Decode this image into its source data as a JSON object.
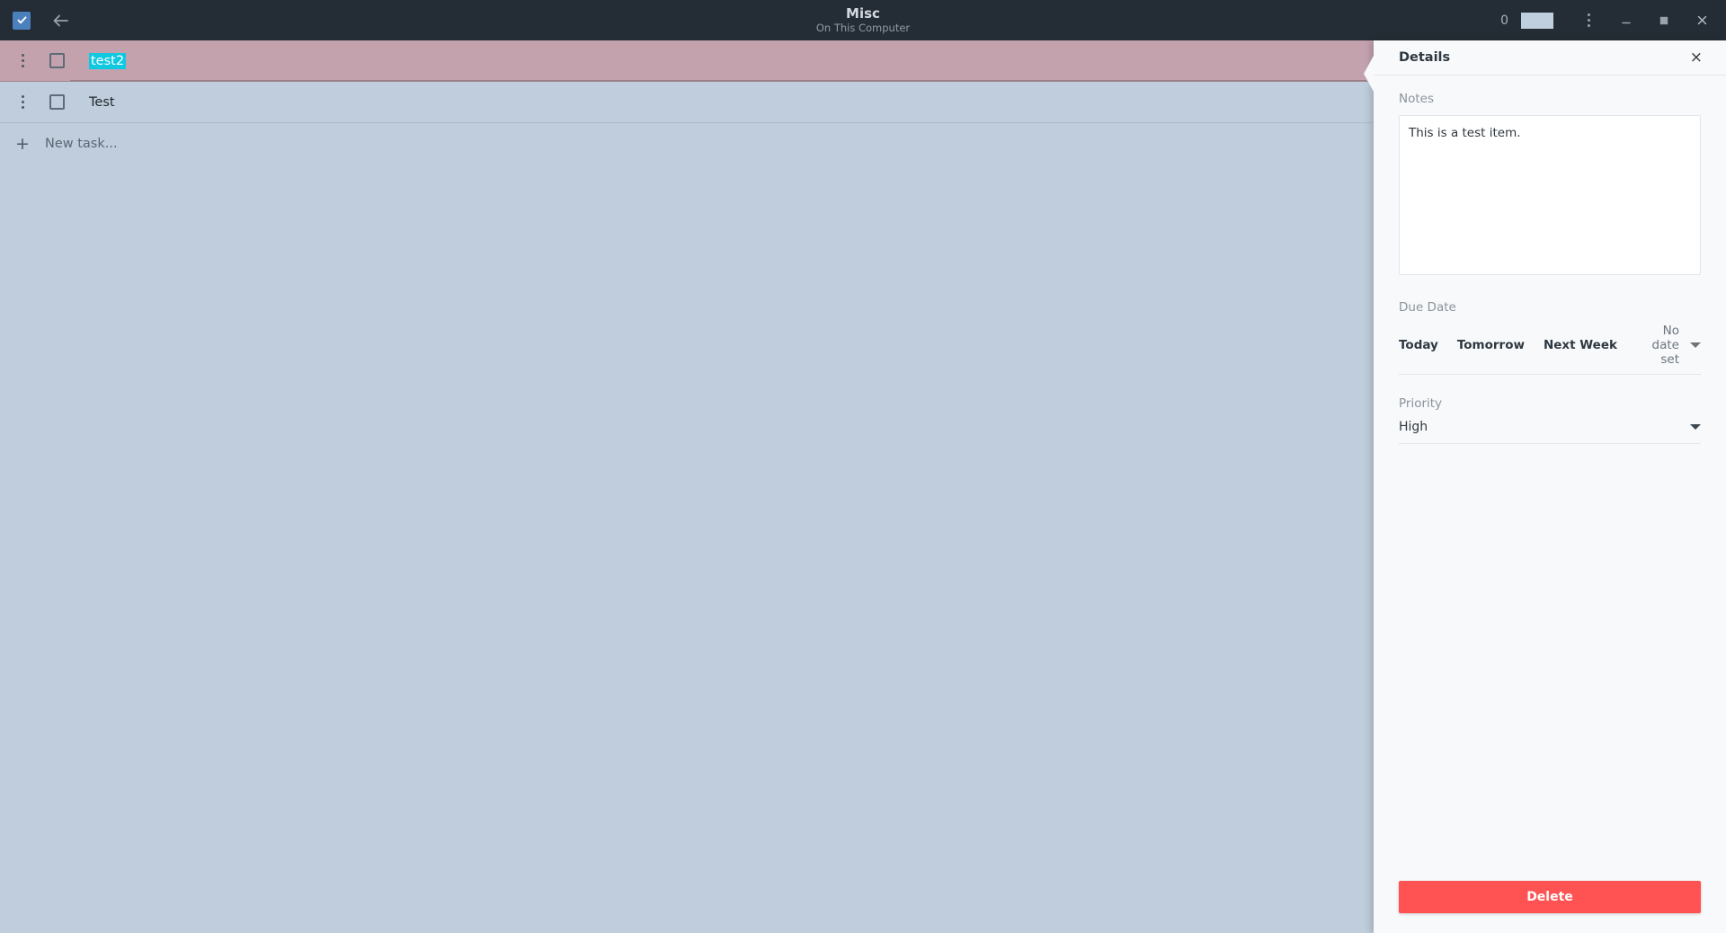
{
  "titlebar": {
    "app_icon": "checkbox-check-icon",
    "back_icon": "arrow-left-icon",
    "title": "Misc",
    "subtitle": "On This Computer",
    "count": "0",
    "menu_icon": "kebab-menu-icon",
    "minimize_icon": "minimize-icon",
    "maximize_icon": "maximize-icon",
    "close_icon": "close-icon",
    "colors": {
      "background": "#242d35",
      "title": "#d3d9de",
      "subtitle": "#8f9aa3",
      "progress": "#bfcfdd"
    }
  },
  "list": {
    "tasks": [
      {
        "title": "test2",
        "checked": false,
        "selected": true,
        "editing": true
      },
      {
        "title": "Test",
        "checked": false,
        "selected": false,
        "editing": false
      }
    ],
    "new_task_placeholder": "New task...",
    "new_task_icon": "plus-icon",
    "colors": {
      "selected_row": "#c3a2ae",
      "row": "#bfcddc",
      "edit_highlight": "#10c8e0"
    }
  },
  "details": {
    "heading": "Details",
    "close_label": "×",
    "notes": {
      "label": "Notes",
      "value": "This is a test item.",
      "placeholder": "Notes"
    },
    "due_date": {
      "label": "Due Date",
      "buttons": [
        "Today",
        "Tomorrow",
        "Next Week"
      ],
      "selected": "No date set",
      "caret_icon": "chevron-down-icon"
    },
    "priority": {
      "label": "Priority",
      "value": "High",
      "caret_icon": "chevron-down-icon"
    },
    "delete_label": "Delete",
    "colors": {
      "panel": "#f8f9fb",
      "delete": "#ff5252"
    }
  }
}
